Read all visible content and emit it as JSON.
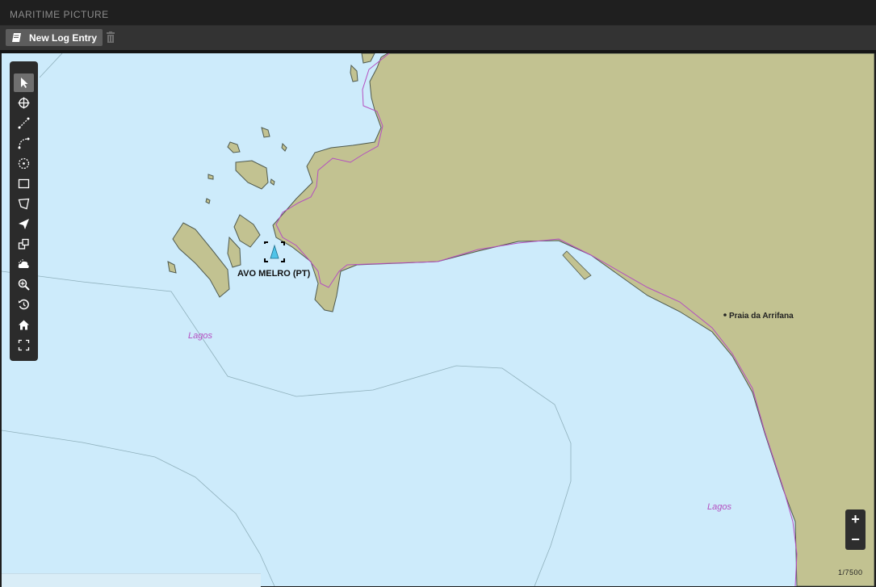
{
  "window": {
    "title": "MARITIME PICTURE"
  },
  "toolbar": {
    "new_log_label": "New Log Entry",
    "new_log_icon": "book-icon",
    "delete_icon": "trash-icon"
  },
  "map_tools": [
    {
      "name": "select-pointer-icon",
      "active": true
    },
    {
      "name": "crosshair-icon"
    },
    {
      "name": "measure-distance-icon"
    },
    {
      "name": "arc-icon"
    },
    {
      "name": "circle-icon"
    },
    {
      "name": "rectangle-icon"
    },
    {
      "name": "polygon-icon"
    },
    {
      "name": "send-icon"
    },
    {
      "name": "layers-icon"
    },
    {
      "name": "weather-icon"
    },
    {
      "name": "zoom-area-icon"
    },
    {
      "name": "history-icon"
    },
    {
      "name": "home-icon"
    },
    {
      "name": "fullscreen-icon"
    }
  ],
  "map": {
    "vessel_label": "AVO MELRO (PT)",
    "place_label": "Praia da Arrifana",
    "area_labels": [
      "Lagos",
      "Lagos"
    ],
    "scale": "1/7500",
    "zoom_in": "+",
    "zoom_out": "−",
    "colors": {
      "sea": "#cdebfb",
      "land": "#c2c291",
      "boundary": "#b44fc0",
      "vessel": "#4fc3e8"
    }
  }
}
